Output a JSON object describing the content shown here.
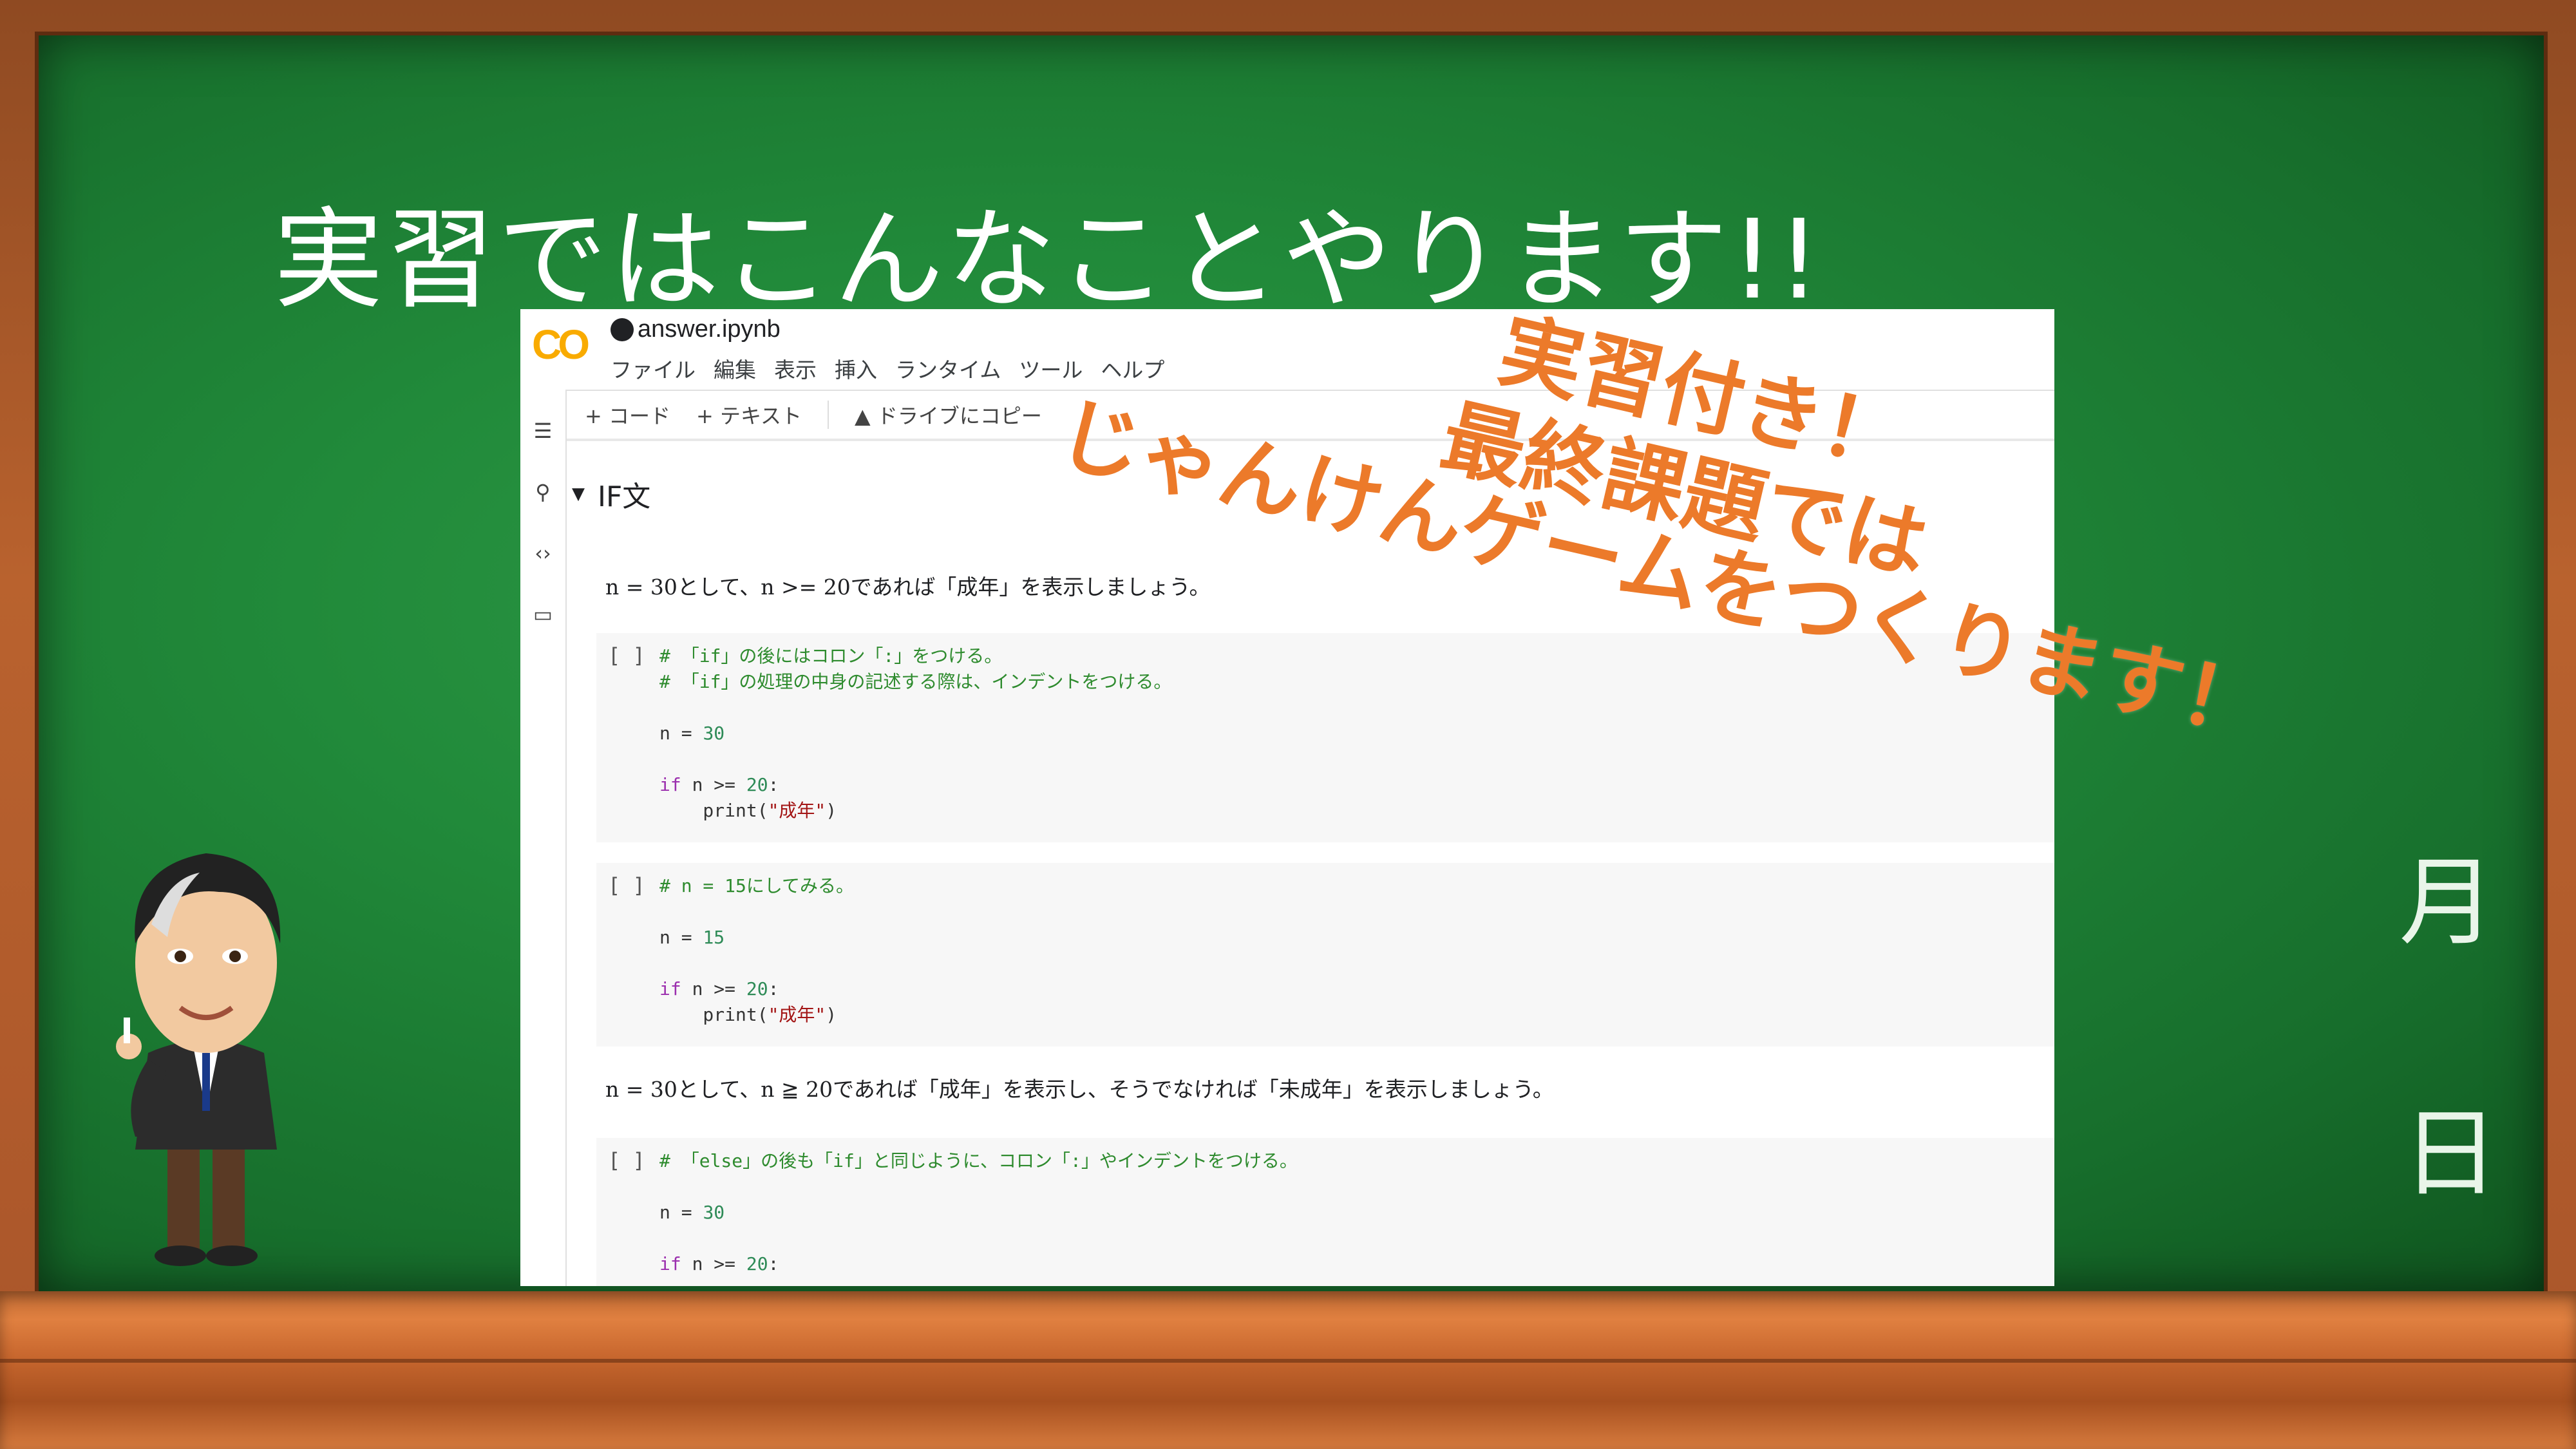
{
  "slide": {
    "title": "実習ではこんなことやります!!",
    "date_month": "月",
    "date_day": "日",
    "overlay_lines": [
      "実習付き！",
      "最終課題では",
      "じゃんけんゲームをつくります！"
    ],
    "overlay_color": "#ec7a2a"
  },
  "colab": {
    "logo": "CO",
    "file_name": "answer.ipynb",
    "menu": [
      "ファイル",
      "編集",
      "表示",
      "挿入",
      "ランタイム",
      "ツール",
      "ヘルプ"
    ],
    "toolbar": [
      "+ コード",
      "+ テキスト",
      "ドライブにコピー"
    ],
    "section_title": "IF文",
    "md1": "n = 30として、n >= 20であれば「成年」を表示しましょう。",
    "md2": "n = 30として、n ≧ 20であれば「成年」を表示し、そうでなければ「未成年」を表示しましょう。",
    "cell_run": "[ ]",
    "cells": [
      {
        "comment1": "# 「if」の後にはコロン「:」をつける。",
        "comment2": "# 「if」の処理の中身の記述する際は、インデントをつける。",
        "assign": "n = ",
        "assign_num": "30",
        "if_kw": "if",
        "if_rest": " n >= ",
        "if_num": "20",
        "if_colon": ":",
        "print_fn": "    print(",
        "print_str": "\"成年\"",
        "print_close": ")"
      },
      {
        "comment1": "# n = 15にしてみる。",
        "assign": "n = ",
        "assign_num": "15",
        "if_kw": "if",
        "if_rest": " n >= ",
        "if_num": "20",
        "if_colon": ":",
        "print_fn": "    print(",
        "print_str": "\"成年\"",
        "print_close": ")"
      },
      {
        "comment1": "# 「else」の後も「if」と同じように、コロン「:」やインデントをつける。",
        "assign": "n = ",
        "assign_num": "30",
        "if_kw": "if",
        "if_rest": " n >= ",
        "if_num": "20",
        "if_colon": ":"
      }
    ]
  }
}
